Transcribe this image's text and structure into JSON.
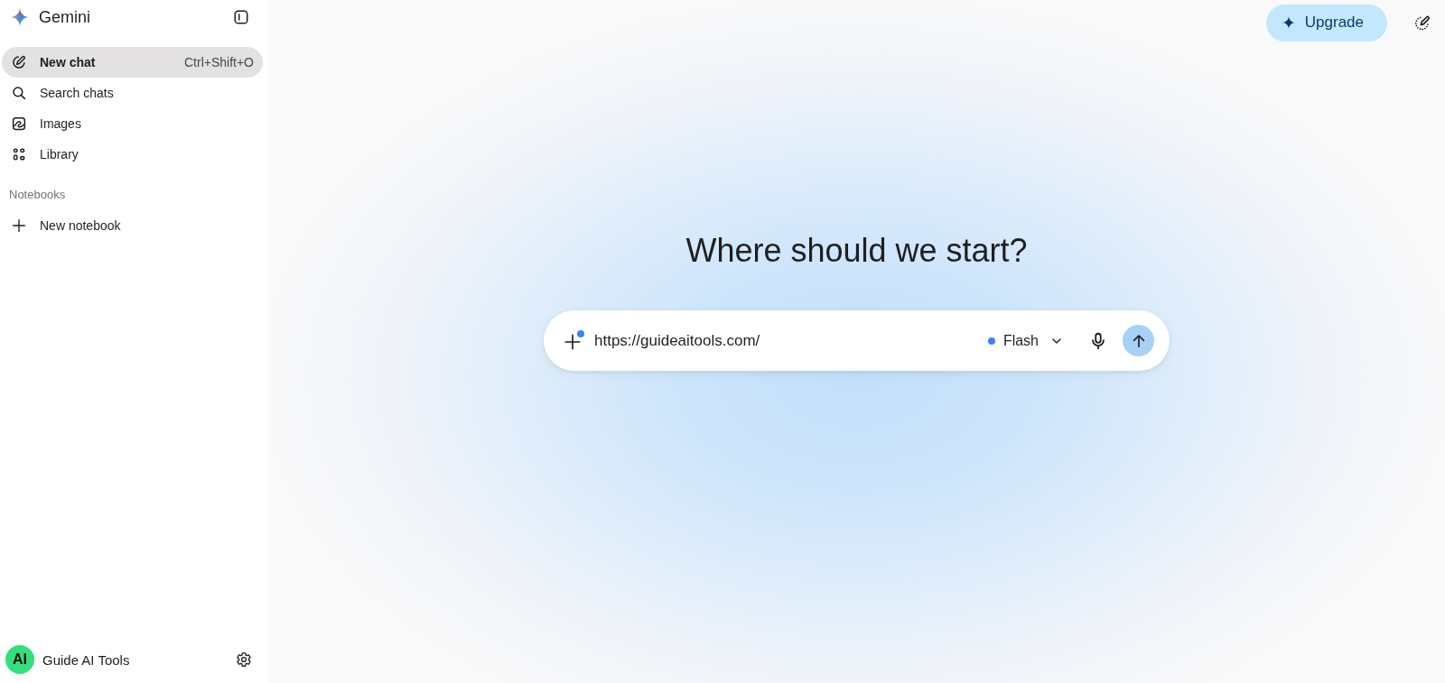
{
  "sidebar": {
    "brand": "Gemini",
    "items": [
      {
        "label": "New chat",
        "shortcut": "Ctrl+Shift+O",
        "selected": true
      },
      {
        "label": "Search chats",
        "selected": false
      },
      {
        "label": "Images",
        "selected": false
      },
      {
        "label": "Library",
        "selected": false
      }
    ],
    "section": {
      "title": "Notebooks",
      "action": "New notebook"
    },
    "account": {
      "initials": "AI",
      "name": "Guide AI Tools"
    }
  },
  "header": {
    "upgrade": "Upgrade"
  },
  "main": {
    "heading": "Where should we start?",
    "prompt": {
      "value": "https://guideaitools.com/",
      "attachment_badge": true
    },
    "model": "Flash"
  }
}
